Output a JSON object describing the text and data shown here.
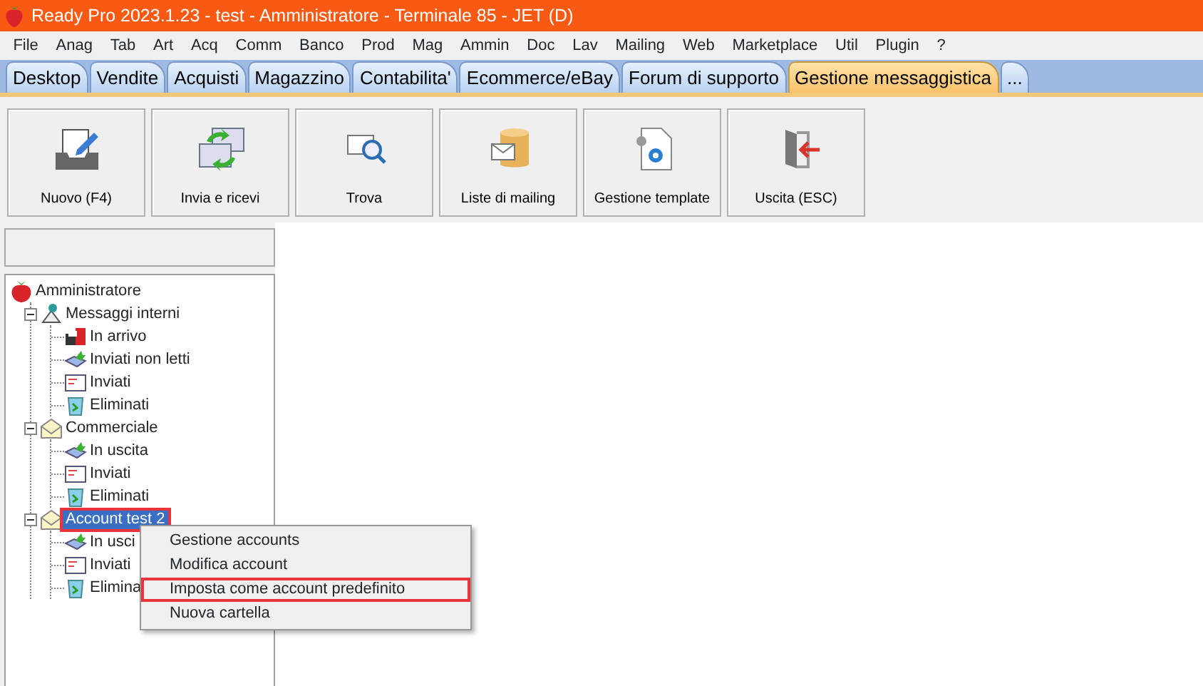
{
  "window": {
    "title": "Ready Pro 2023.1.23 - test - Amministratore - Terminale 85 - JET (D)"
  },
  "menu": [
    "File",
    "Anag",
    "Tab",
    "Art",
    "Acq",
    "Comm",
    "Banco",
    "Prod",
    "Mag",
    "Ammin",
    "Doc",
    "Lav",
    "Mailing",
    "Web",
    "Marketplace",
    "Util",
    "Plugin",
    "?"
  ],
  "tabs": [
    {
      "label": "Desktop",
      "selected": false
    },
    {
      "label": "Vendite",
      "selected": false
    },
    {
      "label": "Acquisti",
      "selected": false
    },
    {
      "label": "Magazzino",
      "selected": false
    },
    {
      "label": "Contabilita'",
      "selected": false
    },
    {
      "label": "Ecommerce/eBay",
      "selected": false
    },
    {
      "label": "Forum di supporto",
      "selected": false
    },
    {
      "label": "Gestione messaggistica",
      "selected": true
    },
    {
      "label": "...",
      "selected": false
    }
  ],
  "toolbar": [
    "Nuovo (F4)",
    "Invia e ricevi",
    "Trova",
    "Liste di mailing",
    "Gestione template",
    "Uscita (ESC)"
  ],
  "tree": {
    "label": "Amministratore",
    "kind": "root",
    "children": [
      {
        "label": "Messaggi interni",
        "kind": "internal",
        "expanded": true,
        "highlighted": false,
        "children": [
          {
            "label": "In arrivo",
            "kind": "inbox"
          },
          {
            "label": "Inviati non letti",
            "kind": "outbox"
          },
          {
            "label": "Inviati",
            "kind": "sent"
          },
          {
            "label": "Eliminati",
            "kind": "deleted"
          }
        ]
      },
      {
        "label": "Commerciale",
        "kind": "account",
        "expanded": true,
        "highlighted": false,
        "children": [
          {
            "label": "In uscita",
            "kind": "outbox"
          },
          {
            "label": "Inviati",
            "kind": "sent"
          },
          {
            "label": "Eliminati",
            "kind": "deleted"
          }
        ]
      },
      {
        "label": "Account  test 2",
        "kind": "account",
        "expanded": true,
        "highlighted": true,
        "children": [
          {
            "label": "In usci",
            "kind": "outbox"
          },
          {
            "label": "Inviati",
            "kind": "sent"
          },
          {
            "label": "Elimina",
            "kind": "deleted"
          }
        ]
      }
    ]
  },
  "context_menu": [
    {
      "label": "Gestione accounts",
      "highlighted": false
    },
    {
      "label": "Modifica account",
      "highlighted": false
    },
    {
      "label": "Imposta come account predefinito",
      "highlighted": true
    },
    {
      "label": "Nuova cartella",
      "highlighted": false
    }
  ]
}
